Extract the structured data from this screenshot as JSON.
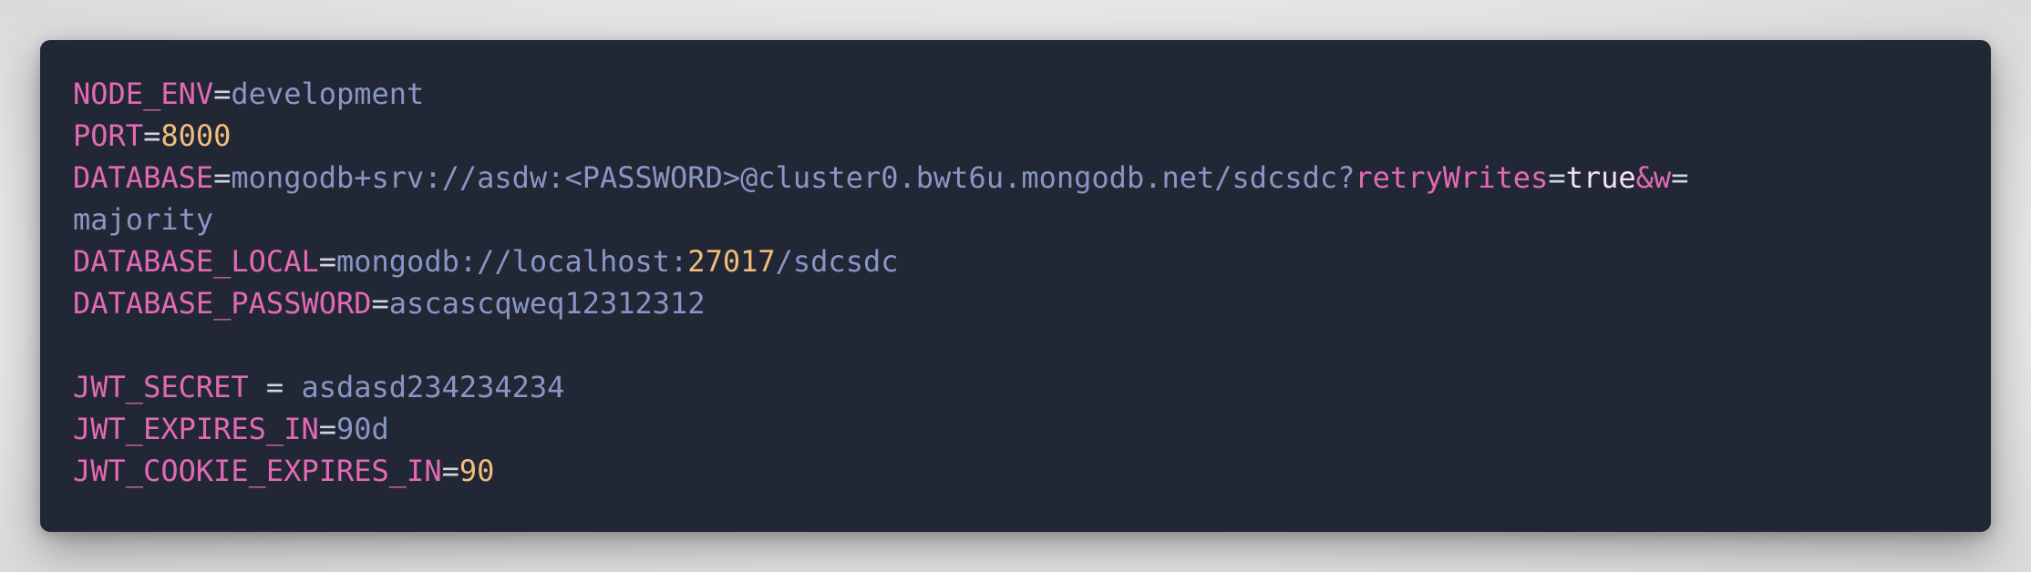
{
  "colors": {
    "background": "#222735",
    "key": "#e26ab4",
    "value": "#8896c5",
    "number": "#f2bd7c",
    "operator": "#d0d3e0",
    "boolean": "#f4e3f2"
  },
  "lines": [
    {
      "key": "NODE_ENV",
      "eq": "=",
      "value": "development"
    },
    {
      "key": "PORT",
      "eq": "=",
      "value_num": "8000"
    },
    {
      "key": "DATABASE",
      "eq": "=",
      "value": "mongodb+srv://asdw:<PASSWORD>@cluster0.bwt6u.mongodb.net/sdcsdc?",
      "param1_key": "retryWrites",
      "param1_eq": "=",
      "param1_value": "true",
      "amp": "&",
      "param2_key": "w",
      "param2_eq": "=",
      "wrap_value": "majority"
    },
    {
      "key": "DATABASE_LOCAL",
      "eq": "=",
      "value": "mongodb://localhost:",
      "port": "27017",
      "path": "/sdcsdc"
    },
    {
      "key": "DATABASE_PASSWORD",
      "eq": "=",
      "value": "ascascqweq12312312"
    },
    {
      "key": "JWT_SECRET",
      "eq": " = ",
      "value": "asdasd234234234"
    },
    {
      "key": "JWT_EXPIRES_IN",
      "eq": "=",
      "value": "90d"
    },
    {
      "key": "JWT_COOKIE_EXPIRES_IN",
      "eq": "=",
      "value_num": "90"
    }
  ]
}
